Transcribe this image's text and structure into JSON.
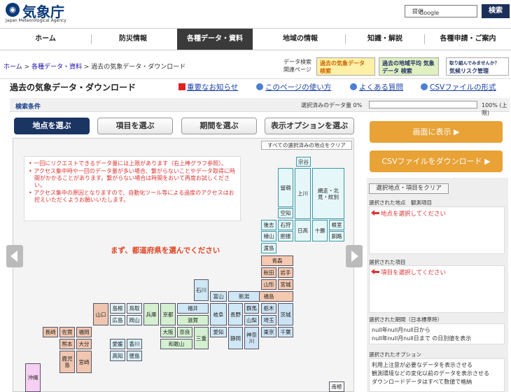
{
  "header": {
    "logo_text": "気象庁",
    "logo_sub": "Japan Meteorological Agency",
    "search_placeholder_brand": "Google",
    "search_placeholder_suffix": "提供",
    "search_button": "検索"
  },
  "nav": [
    "ホーム",
    "防災情報",
    "各種データ・資料",
    "地域の情報",
    "知識・解説",
    "各種申請・ご案内"
  ],
  "breadcrumb": {
    "home": "ホーム",
    "sep1": " > ",
    "section": "各種データ・資料",
    "sep2": " > ",
    "current": "過去の気象データ・ダウンロード"
  },
  "related": {
    "label_line1": "データ検索",
    "label_line2": "関連ページ",
    "banner1": "過去の気象データ 検索",
    "banner2": "過去の地域平均 気象データ 検索",
    "banner3_line1": "取り組んでみませんか？",
    "banner3_line2": "気候リスク管理"
  },
  "page": {
    "title": "過去の気象データ・ダウンロード",
    "link_notice": "重要なお知らせ",
    "link_usage": "このページの使い方",
    "link_faq": "よくある質問",
    "link_csv": "CSVファイルの形式"
  },
  "conditions": {
    "label": "検索条件",
    "data_amount_label": "選択済みのデータ量 0%",
    "data_amount_max": "100% (上限)",
    "data_amount_pct": 0
  },
  "tabs": [
    "地点を選ぶ",
    "項目を選ぶ",
    "期間を選ぶ",
    "表示オプションを選ぶ"
  ],
  "map": {
    "clear_all": "すべての選択済みの地点をクリア",
    "notices": [
      "一回にリクエストできるデータ量には上限があります（右上棒グラフ参照）。",
      "アクセス集中時や一回のデータ量が多い場合、繋がらないことやデータ取得に時間がかかることがあります。繋がらない場合は時間をおいて再度お試しください。",
      "アクセス集中の原因となりますので、自動化ツール等による過度のアクセスはお控えいただくようお願いいたします。"
    ],
    "instruction": "まず、都道府県を選んでください",
    "prefectures": {
      "soya": "宗谷",
      "rumoi": "留萌",
      "kamikawa": "上川",
      "abashiri": "網走・北見・紋別",
      "sorachi": "空知",
      "shiribeshi": "後志",
      "ishikari": "石狩",
      "hidaka": "日高",
      "tokachi": "十勝",
      "nemuro": "根室",
      "kushiro": "釧路",
      "hiyama": "檜山",
      "iburi": "胆振",
      "oshima": "渡島",
      "aomori": "青森",
      "akita": "秋田",
      "iwate": "岩手",
      "yamagata": "山形",
      "miyagi": "宮城",
      "fukushima": "福島",
      "ishikawa": "石川",
      "toyama": "富山",
      "niigata": "新潟",
      "fukui": "福井",
      "gifu": "岐阜",
      "nagano": "長野",
      "gunma": "群馬",
      "tochigi": "栃木",
      "ibaraki": "茨城",
      "shiga": "滋賀",
      "yamanashi": "山梨",
      "saitama": "埼玉",
      "kyoto": "京都",
      "hyogo": "兵庫",
      "shimane": "島根",
      "tottori": "鳥取",
      "yamaguchi": "山口",
      "hiroshima": "広島",
      "okayama": "岡山",
      "osaka": "大阪",
      "nara": "奈良",
      "mie": "三重",
      "aichi": "愛知",
      "shizuoka": "静岡",
      "kanagawa": "神奈川",
      "tokyo": "東京",
      "chiba": "千葉",
      "wakayama": "和歌山",
      "nagasaki": "長崎",
      "saga": "佐賀",
      "fukuoka": "福岡",
      "kumamoto": "熊本",
      "oita": "大分",
      "ehime": "愛媛",
      "kagawa": "香川",
      "kochi": "高知",
      "tokushima": "徳島",
      "kagoshima": "鹿児島",
      "miyazaki": "宮崎",
      "okinawa": "沖縄",
      "minamitori": "南極"
    }
  },
  "right": {
    "display_btn": "画面に表示 ▶",
    "csv_btn": "CSVファイルをダウンロード ▶",
    "clear_sel": "選択地点・項目をクリア",
    "sel_points_label": "選択された地点　観測項目",
    "sel_points_msg": "地点を選択してください",
    "sel_items_label": "選択された項目",
    "sel_items_msg": "項目を選択してください",
    "period_label": "選択された期間（日本標準時）",
    "period_line1": "null年null月null日から",
    "period_line2": "null年null月null日まで の日別値を表示",
    "option_label": "選択されたオプション",
    "option_lines": [
      "利用上注意が必要なデータを表示させる",
      "観測環境などの変化以前のデータを表示させる",
      "ダウンロードデータはすべて数値で格納"
    ]
  },
  "colors": {
    "brand_navy": "#1b3563",
    "orange_button": "#e8a236",
    "warning_red": "#d33"
  }
}
